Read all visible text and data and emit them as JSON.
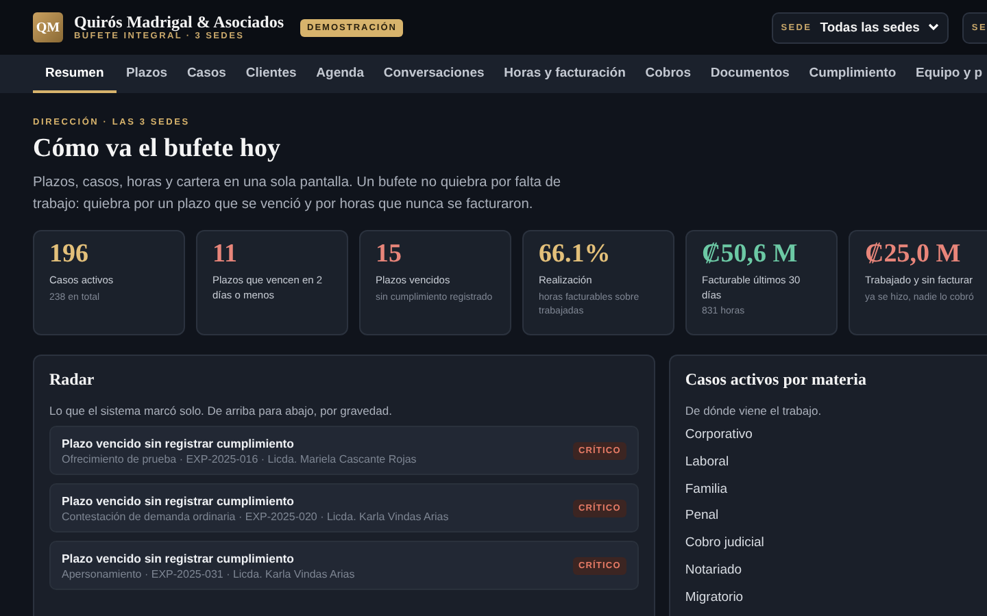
{
  "brand": {
    "logo": "QM",
    "name": "Quirós Madrigal & Asociados",
    "subtitle": "BUFETE INTEGRAL · 3 SEDES",
    "badge": "DEMOSTRACIÓN"
  },
  "selectors": [
    {
      "label": "SEDE",
      "value": "Todas las sedes"
    },
    {
      "label": "SE"
    }
  ],
  "tabs": [
    {
      "label": "Resumen",
      "selected": true
    },
    {
      "label": "Plazos",
      "selected": false
    },
    {
      "label": "Casos",
      "selected": false
    },
    {
      "label": "Clientes",
      "selected": false
    },
    {
      "label": "Agenda",
      "selected": false
    },
    {
      "label": "Conversaciones",
      "selected": false
    },
    {
      "label": "Horas y facturación",
      "selected": false
    },
    {
      "label": "Cobros",
      "selected": false
    },
    {
      "label": "Documentos",
      "selected": false
    },
    {
      "label": "Cumplimiento",
      "selected": false
    },
    {
      "label": "Equipo y p",
      "selected": false
    }
  ],
  "eyebrow": "DIRECCIÓN · LAS 3 SEDES",
  "title": "Cómo va el bufete hoy",
  "intro": "Plazos, casos, horas y cartera en una sola pantalla. Un bufete no quiebra por falta de trabajo: quiebra por un plazo que se venció y por horas que nunca se facturaron.",
  "stats": [
    {
      "value": "196",
      "color": "#e3c07a",
      "label": "Casos activos",
      "note": "238 en total"
    },
    {
      "value": "11",
      "color": "#e8857a",
      "label": "Plazos que vencen en 2 días o menos"
    },
    {
      "value": "15",
      "color": "#e8857a",
      "label": "Plazos vencidos",
      "note": "sin cumplimiento registrado"
    },
    {
      "value": "66.1%",
      "color": "#e3c07a",
      "label": "Realización",
      "note": "horas facturables sobre trabajadas"
    },
    {
      "value": "₡50,6 M",
      "color": "#6cc9a5",
      "label": "Facturable últimos 30 días",
      "note": "831 horas"
    },
    {
      "value": "₡25,0 M",
      "color": "#e8857a",
      "label": "Trabajado y sin facturar",
      "note": "ya se hizo, nadie lo cobró"
    }
  ],
  "radar": {
    "title": "Radar",
    "subtitle": "Lo que el sistema marcó solo. De arriba para abajo, por gravedad.",
    "items": [
      {
        "title": "Plazo vencido sin registrar cumplimiento",
        "detail": "Ofrecimiento de prueba · EXP-2025-016 · Licda. Mariela Cascante Rojas",
        "severity": "CRÍTICO"
      },
      {
        "title": "Plazo vencido sin registrar cumplimiento",
        "detail": "Contestación de demanda ordinaria · EXP-2025-020 · Licda. Karla Vindas Arias",
        "severity": "CRÍTICO"
      },
      {
        "title": "Plazo vencido sin registrar cumplimiento",
        "detail": "Apersonamiento · EXP-2025-031 · Licda. Karla Vindas Arias",
        "severity": "CRÍTICO"
      }
    ]
  },
  "by_matter": {
    "title": "Casos activos por materia",
    "subtitle": "De dónde viene el trabajo.",
    "items": [
      "Corporativo",
      "Laboral",
      "Familia",
      "Penal",
      "Cobro judicial",
      "Notariado",
      "Migratorio"
    ]
  }
}
